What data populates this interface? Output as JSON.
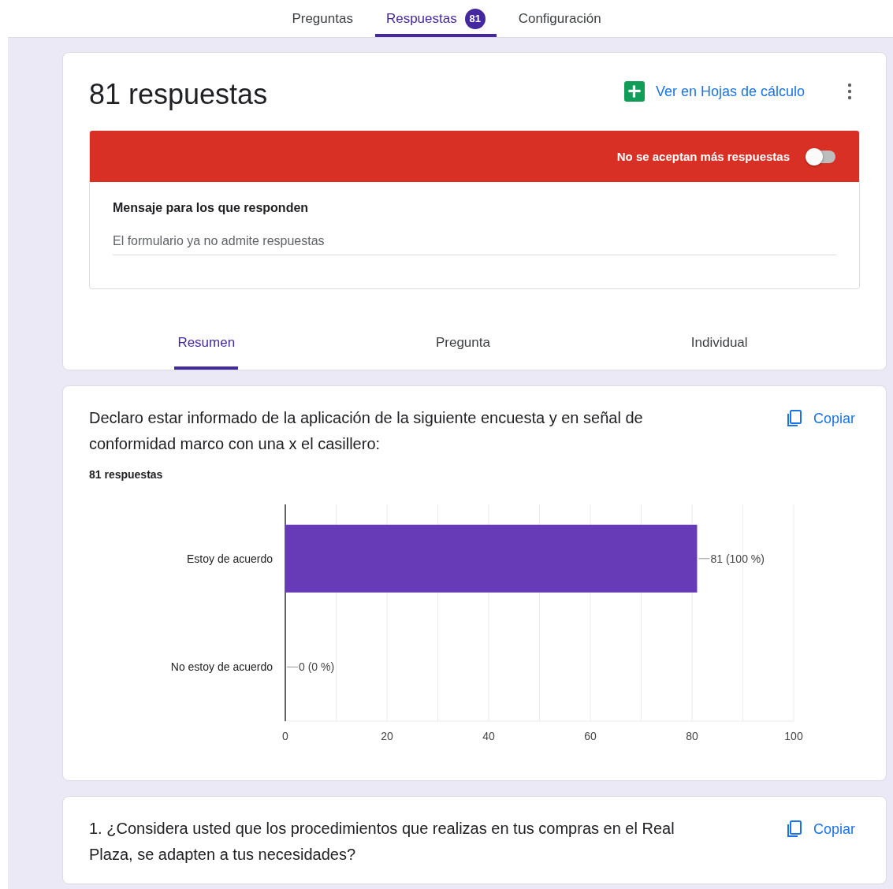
{
  "top_tabs": [
    {
      "label": "Preguntas",
      "selected": false
    },
    {
      "label": "Respuestas",
      "selected": true,
      "badge": "81"
    },
    {
      "label": "Configuración",
      "selected": false
    }
  ],
  "summary": {
    "title": "81 respuestas",
    "sheets_link": "Ver en Hojas de cálculo",
    "banner": {
      "label": "No se aceptan más respuestas",
      "on": false
    },
    "message": {
      "label": "Mensaje para los que responden",
      "value": "El formulario ya no admite respuestas"
    }
  },
  "view_tabs": [
    {
      "label": "Resumen",
      "selected": true
    },
    {
      "label": "Pregunta",
      "selected": false
    },
    {
      "label": "Individual",
      "selected": false
    }
  ],
  "questions": [
    {
      "title": "Declaro estar informado de la aplicación de la siguiente encuesta y en señal de conformidad marco con una x el casillero:",
      "copy": "Copiar",
      "count": "81 respuestas",
      "chart_data": {
        "type": "bar",
        "orientation": "horizontal",
        "categories": [
          "Estoy de acuerdo",
          "No estoy de acuerdo"
        ],
        "series": [
          {
            "color": "#673ab7",
            "values": [
              81,
              0
            ]
          }
        ],
        "grid": true,
        "value_labels": [
          "81 (100 %)",
          "0 (0 %)"
        ],
        "xlim": [
          0,
          100
        ],
        "xticks": [
          0,
          20,
          40,
          60,
          80,
          100
        ]
      }
    },
    {
      "title": "1. ¿Considera usted que los procedimientos que realizas en tus compras en el Real Plaza, se adapten a tus necesidades?",
      "copy": "Copiar"
    }
  ]
}
